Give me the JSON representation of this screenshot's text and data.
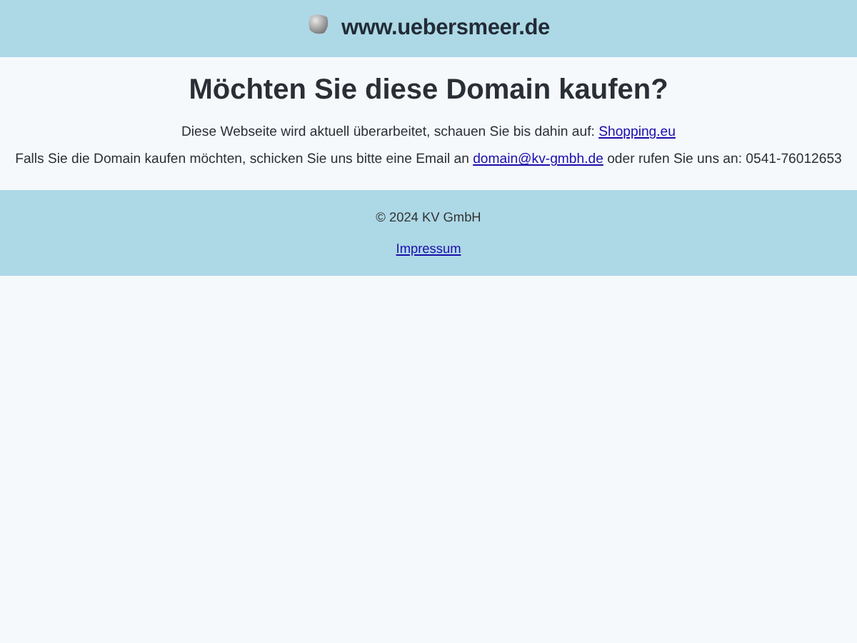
{
  "header": {
    "site_name": "www.uebersmeer.de"
  },
  "main": {
    "heading": "Möchten Sie diese Domain kaufen?",
    "paragraphs": [
      {
        "before": "Diese Webseite wird aktuell überarbeitet, schauen Sie bis dahin auf: ",
        "link": "Shopping.eu"
      },
      {
        "before": "Falls Sie die Domain kaufen möchten, schicken Sie uns bitte eine Email an ",
        "link": "domain@kv-gmbh.de",
        "after": " oder rufen Sie uns an: 0541-76012653"
      }
    ]
  },
  "footer": {
    "copyright": "© 2024 KV GmbH",
    "link": "Impressum"
  }
}
